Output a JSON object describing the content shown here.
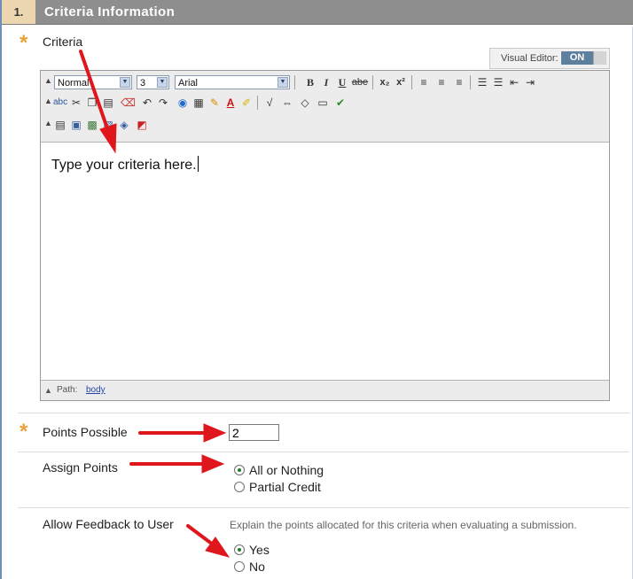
{
  "section": {
    "step_number": "1.",
    "title": "Criteria Information"
  },
  "criteria": {
    "label": "Criteria",
    "required_marker": "*",
    "visual_editor": {
      "label": "Visual Editor:",
      "state": "ON"
    },
    "toolbar": {
      "format_select": "Normal",
      "size_select": "3",
      "font_select": "Arial",
      "row1_icons": [
        "bold-icon",
        "italic-icon",
        "underline-icon",
        "strikethrough-icon",
        "subscript-icon",
        "superscript-icon",
        "align-left-icon",
        "align-center-icon",
        "align-right-icon",
        "ordered-list-icon",
        "unordered-list-icon",
        "outdent-icon",
        "indent-icon"
      ],
      "row2_icons": [
        "spellcheck-icon",
        "cut-icon",
        "copy-icon",
        "paste-icon",
        "eraser-icon",
        "undo-icon",
        "redo-icon",
        "link-icon",
        "table-icon",
        "highlight-pen-icon",
        "text-color-icon",
        "background-color-icon",
        "math-icon",
        "embed-icon",
        "html-icon",
        "preview-icon",
        "checkmark-icon"
      ],
      "row3_icons": [
        "paste-text-icon",
        "image-icon",
        "media-icon",
        "file-icon",
        "mashup-icon",
        "pdf-icon"
      ]
    },
    "content_text": "Type your criteria here.",
    "path": {
      "label": "Path:",
      "value": "body"
    }
  },
  "points_possible": {
    "label": "Points Possible",
    "required_marker": "*",
    "value": "2"
  },
  "assign_points": {
    "label": "Assign Points",
    "options": [
      {
        "label": "All or Nothing",
        "checked": true
      },
      {
        "label": "Partial Credit",
        "checked": false
      }
    ]
  },
  "feedback": {
    "label": "Allow Feedback to User",
    "help_text": "Explain the points allocated for this criteria when evaluating a submission.",
    "options": [
      {
        "label": "Yes",
        "checked": true
      },
      {
        "label": "No",
        "checked": false
      }
    ]
  },
  "colors": {
    "header_bg": "#8e8e8e",
    "step_bg": "#ebd6b0",
    "required_star": "#e8a23a",
    "annotation_arrow": "#e0161d",
    "radio_selected": "#227a2a"
  }
}
